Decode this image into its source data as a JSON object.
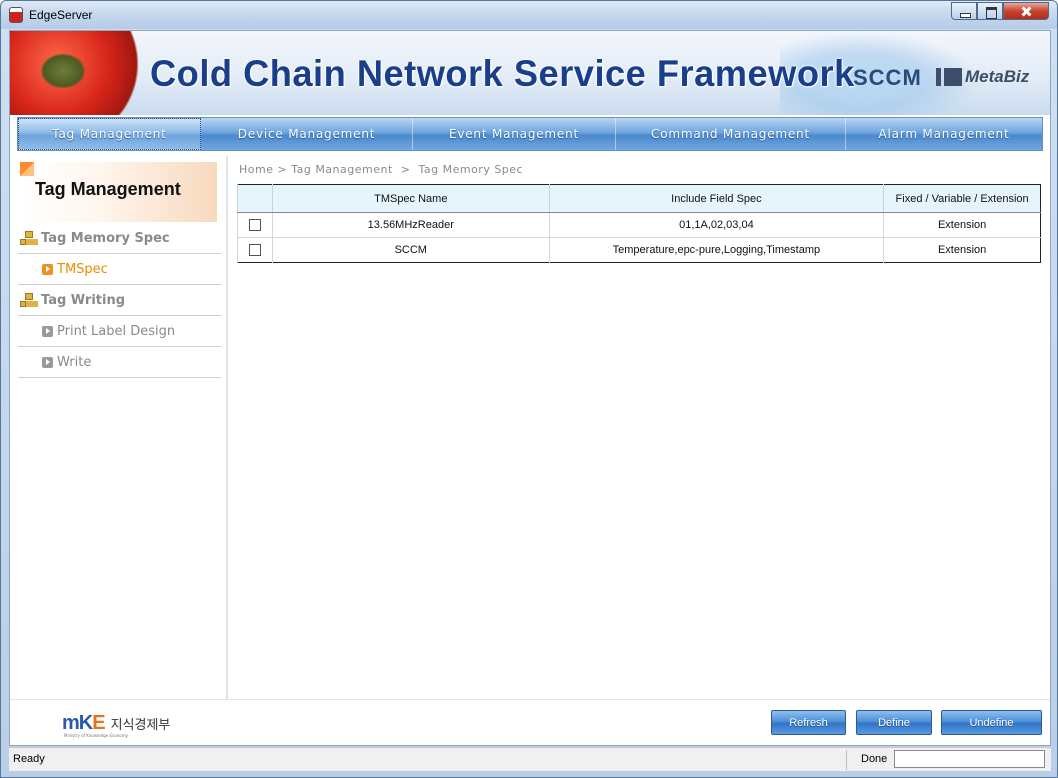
{
  "window": {
    "title": "EdgeServer"
  },
  "banner": {
    "title": "Cold Chain Network Service Framework",
    "brand_sccm": "SCCM",
    "brand_metabiz": "MetaBiz"
  },
  "nav": {
    "items": [
      {
        "label": "Tag Management",
        "active": true
      },
      {
        "label": "Device Management",
        "active": false
      },
      {
        "label": "Event Management",
        "active": false
      },
      {
        "label": "Command Management",
        "active": false
      },
      {
        "label": "Alarm Management",
        "active": false
      }
    ]
  },
  "sidebar": {
    "title": "Tag Management",
    "groups": [
      {
        "label": "Tag Memory Spec",
        "icon": "tree-icon",
        "items": [
          {
            "label": "TMSpec",
            "current": true
          }
        ]
      },
      {
        "label": "Tag Writing",
        "icon": "tree-icon",
        "items": [
          {
            "label": "Print Label Design",
            "current": false
          },
          {
            "label": "Write",
            "current": false
          }
        ]
      }
    ]
  },
  "breadcrumb": "Home > Tag Management  >  Tag Memory Spec",
  "table": {
    "columns": [
      "",
      "TMSpec Name",
      "Include Field Spec",
      "Fixed / Variable / Extension"
    ],
    "rows": [
      {
        "checked": false,
        "name": "13.56MHzReader",
        "fields": "01,1A,02,03,04",
        "type": "Extension"
      },
      {
        "checked": false,
        "name": "SCCM",
        "fields": "Temperature,epc-pure,Logging,Timestamp",
        "type": "Extension"
      }
    ]
  },
  "footer": {
    "logo_text": "mKE",
    "logo_korean": "지식경제부",
    "logo_sub": "Ministry of Knowledge Economy",
    "buttons": {
      "refresh": "Refresh",
      "define": "Define",
      "undefine": "Undefine"
    }
  },
  "status": {
    "left": "Ready",
    "right": "Done"
  },
  "colors": {
    "accent": "#4a8cd6",
    "menu_current": "#f08a00",
    "table_header": "#e5f5fb",
    "banner_title": "#1a3f8a"
  }
}
